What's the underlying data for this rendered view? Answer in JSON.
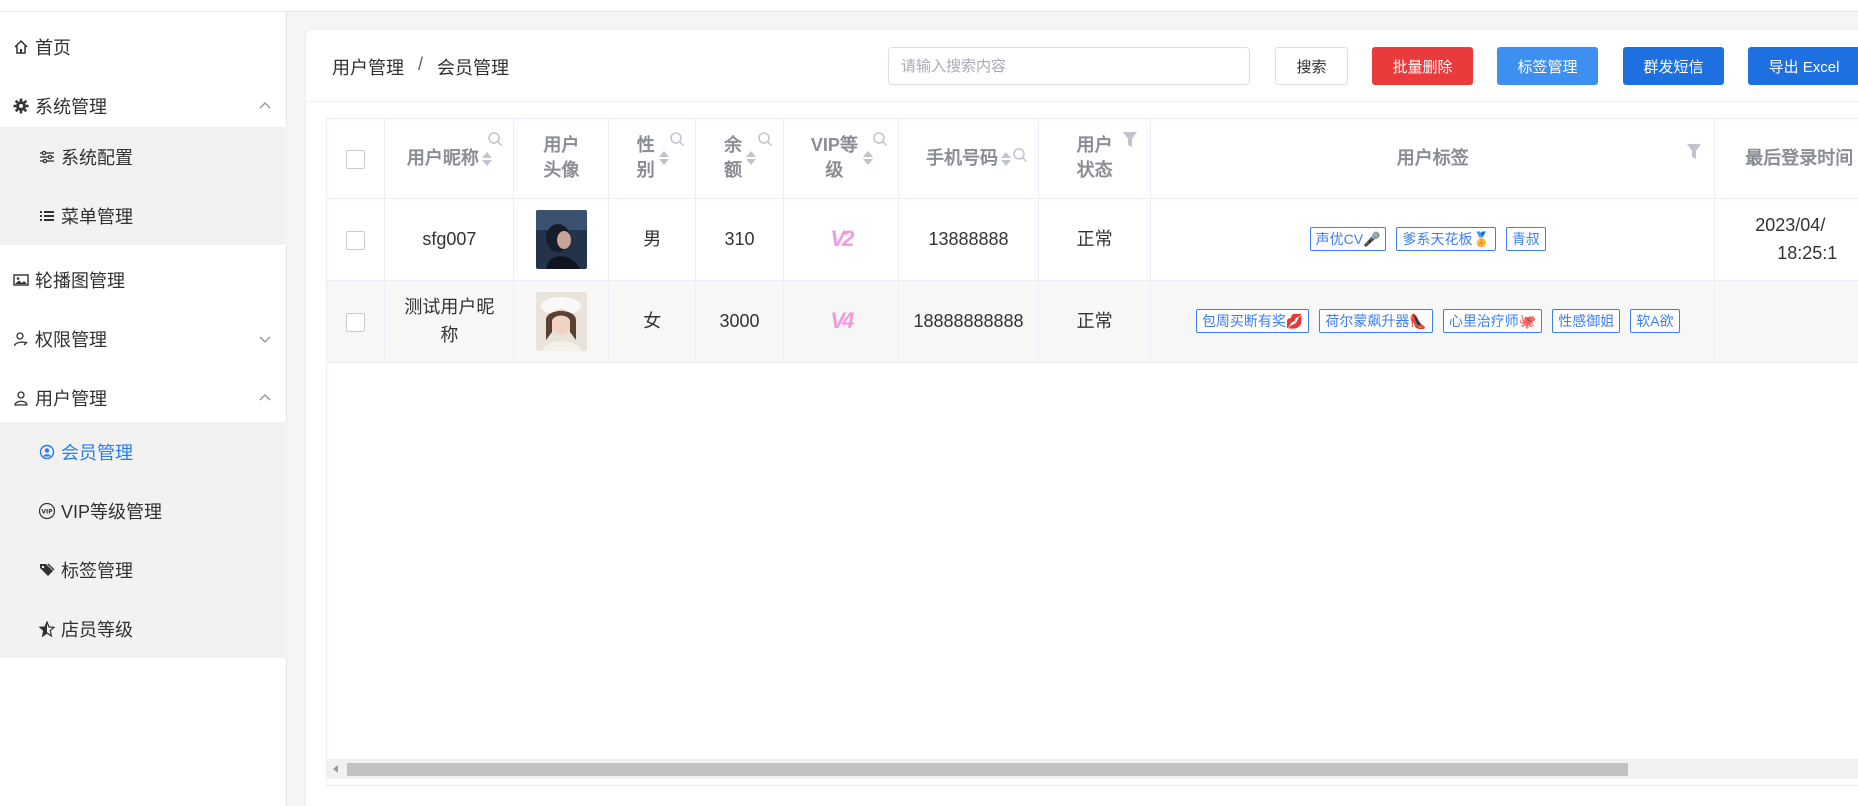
{
  "sidebar": {
    "items": [
      {
        "label": "首页",
        "icon": "home-icon"
      },
      {
        "label": "系统管理",
        "icon": "gear-icon",
        "expanded": true
      },
      {
        "label": "系统配置",
        "icon": "sliders-icon"
      },
      {
        "label": "菜单管理",
        "icon": "list-icon"
      },
      {
        "label": "轮播图管理",
        "icon": "image-icon"
      },
      {
        "label": "权限管理",
        "icon": "user-key-icon",
        "expanded": false
      },
      {
        "label": "用户管理",
        "icon": "user-icon",
        "expanded": true
      },
      {
        "label": "会员管理",
        "icon": "user-circle-icon",
        "active": true
      },
      {
        "label": "VIP等级管理",
        "icon": "vip-icon"
      },
      {
        "label": "标签管理",
        "icon": "tags-icon"
      },
      {
        "label": "店员等级",
        "icon": "star-half-icon"
      }
    ]
  },
  "breadcrumb": {
    "parent": "用户管理",
    "separator": "/",
    "current": "会员管理"
  },
  "toolbar": {
    "search_placeholder": "请输入搜索内容",
    "search_label": "搜索",
    "batch_delete_label": "批量删除",
    "tag_manage_label": "标签管理",
    "sms_label": "群发短信",
    "export_label": "导出 Excel"
  },
  "table": {
    "headers": {
      "nickname": "用户昵称",
      "avatar": "用户头像",
      "gender": "性别",
      "balance": "余额",
      "vip": "VIP等级",
      "phone": "手机号码",
      "status": "用户状态",
      "tags": "用户标签",
      "last_login": "最后登录时间"
    },
    "rows": [
      {
        "nickname": "sfg007",
        "gender": "男",
        "balance": "310",
        "vip": "V2",
        "phone": "13888888",
        "status": "正常",
        "tags": [
          "声优CV🎤",
          "爹系天花板🏅",
          "青叔"
        ],
        "last_login_line1": "2023/04/",
        "last_login_line2": "18:25:1"
      },
      {
        "nickname": "测试用户昵称",
        "gender": "女",
        "balance": "3000",
        "vip": "V4",
        "phone": "18888888888",
        "status": "正常",
        "tags": [
          "包周买断有奖💋",
          "荷尔蒙飙升器👠",
          "心里治疗师🐙",
          "性感御姐",
          "软A欲"
        ],
        "last_login_line1": "",
        "last_login_line2": ""
      }
    ]
  },
  "colors": {
    "accent": "#2b7ce9",
    "danger": "#e93b3b",
    "primary": "#1e6fe0",
    "vip": "#f29bdc"
  }
}
